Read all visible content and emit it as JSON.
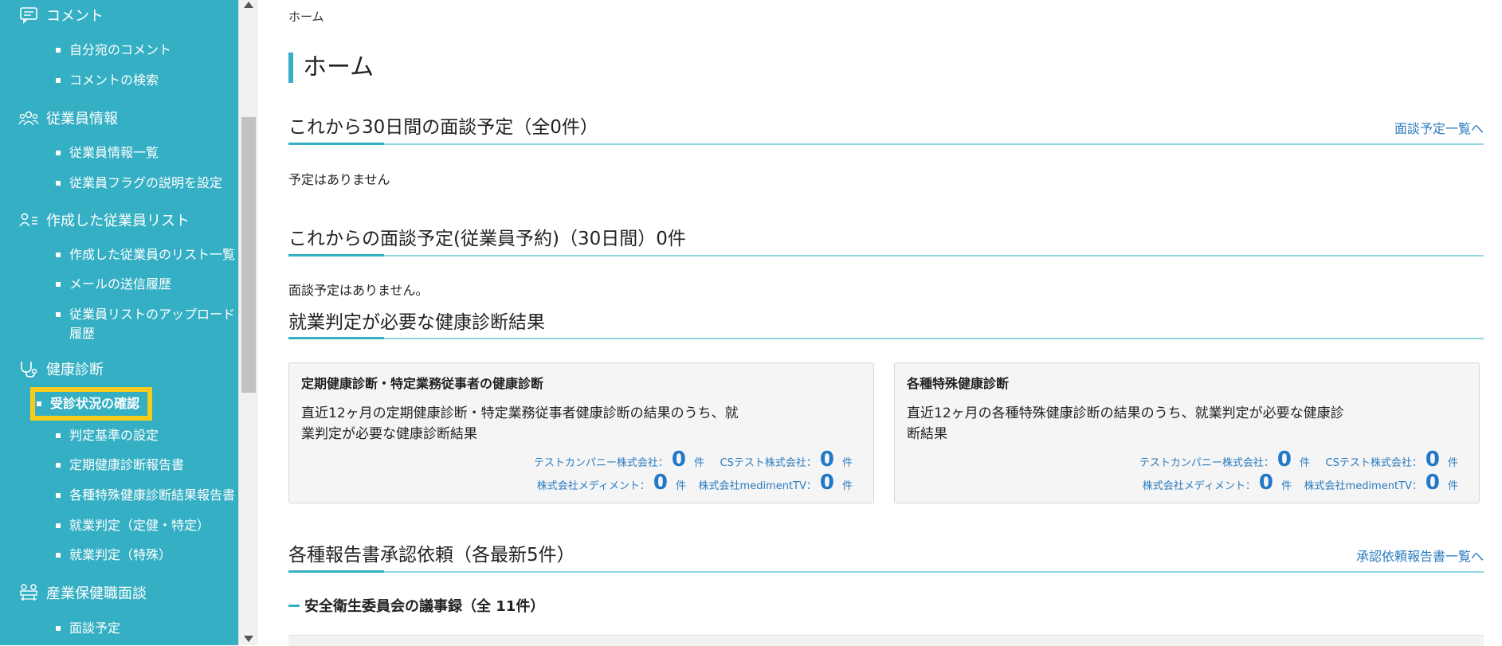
{
  "sidebar": {
    "sections": [
      {
        "label": "コメント",
        "icon": "comment-icon",
        "items": [
          "自分宛のコメント",
          "コメントの検索"
        ]
      },
      {
        "label": "従業員情報",
        "icon": "employees-icon",
        "items": [
          "従業員情報一覧",
          "従業員フラグの説明を設定"
        ]
      },
      {
        "label": "作成した従業員リスト",
        "icon": "person-list-icon",
        "items": [
          "作成した従業員のリスト一覧",
          "メールの送信履歴",
          "従業員リストのアップロード",
          "履歴"
        ]
      },
      {
        "label": "健康診断",
        "icon": "stethoscope-icon",
        "items": [
          "受診状況の確認",
          "判定基準の設定",
          "定期健康診断報告書",
          "各種特殊健康診断結果報告書",
          "就業判定（定健・特定）",
          "就業判定（特殊）"
        ]
      },
      {
        "label": "産業保健職面談",
        "icon": "meeting-icon",
        "items": [
          "面談予定"
        ]
      }
    ],
    "highlight_color": "#f7cc1a",
    "bg_color": "#35afc4"
  },
  "breadcrumb": "ホーム",
  "page_title": "ホーム",
  "sections": {
    "upcoming": {
      "title": "これから30日間の面談予定（全0件）",
      "link": "面談予定一覧へ",
      "empty": "予定はありません"
    },
    "reservations": {
      "title": "これからの面談予定(従業員予約)（30日間）0件",
      "empty": "面談予定はありません。"
    },
    "health": {
      "title": "就業判定が必要な健康診断結果"
    },
    "reports": {
      "title": "各種報告書承認依頼（各最新5件）",
      "link": "承認依頼報告書一覧へ",
      "sub": "安全衛生委員会の議事録（全 11件）"
    }
  },
  "cards": [
    {
      "title": "定期健康診断・特定業務従事者の健康診断",
      "desc1": "直近12ヶ月の定期健康診断・特定業務従事者健康診断の結果のうち、就",
      "desc2": "業判定が必要な健康診断結果",
      "stats": [
        {
          "company": "テストカンパニー株式会社：",
          "count": "0",
          "unit": "件"
        },
        {
          "company": "CSテスト株式会社：",
          "count": "0",
          "unit": "件"
        },
        {
          "company": "株式会社メディメント：",
          "count": "0",
          "unit": "件"
        },
        {
          "company": "株式会社medimentTV：",
          "count": "0",
          "unit": "件"
        }
      ]
    },
    {
      "title": "各種特殊健康診断",
      "desc1": "直近12ヶ月の各種特殊健康診断の結果のうち、就業判定が必要な健康診",
      "desc2": "断結果",
      "stats": [
        {
          "company": "テストカンパニー株式会社：",
          "count": "0",
          "unit": "件"
        },
        {
          "company": "CSテスト株式会社：",
          "count": "0",
          "unit": "件"
        },
        {
          "company": "株式会社メディメント：",
          "count": "0",
          "unit": "件"
        },
        {
          "company": "株式会社medimentTV：",
          "count": "0",
          "unit": "件"
        }
      ]
    }
  ]
}
